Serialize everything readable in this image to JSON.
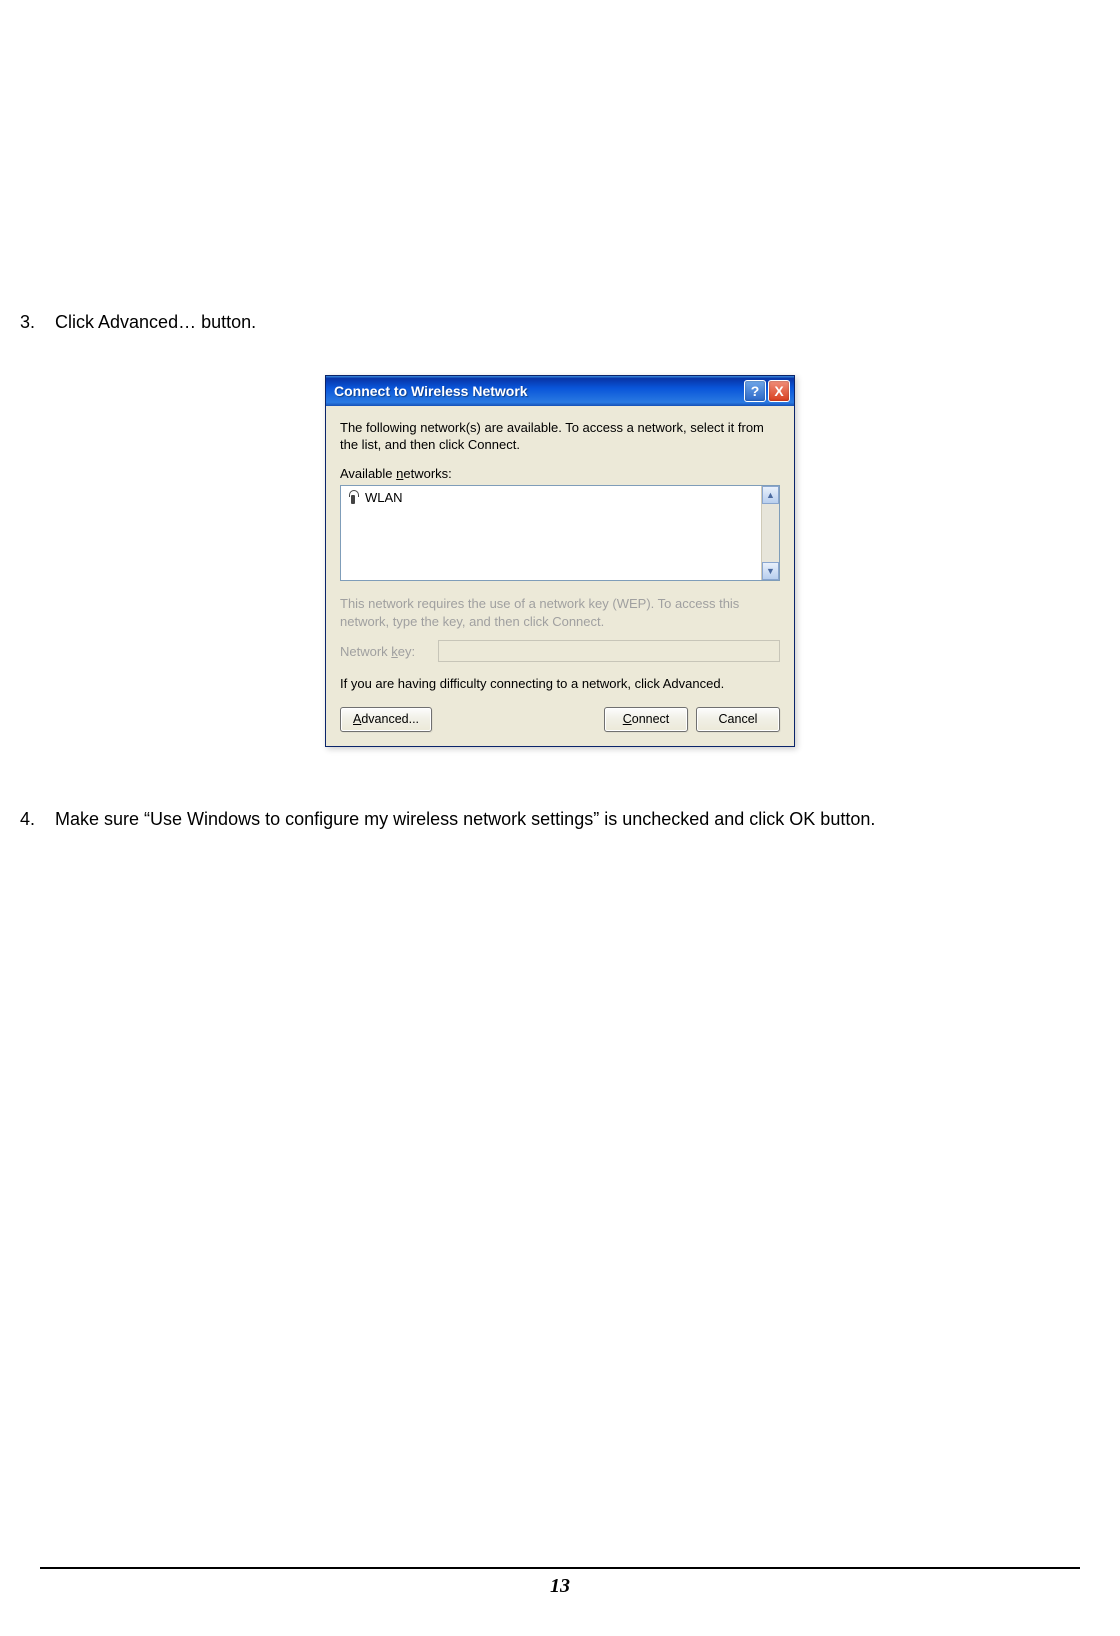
{
  "steps": {
    "s3": {
      "num": "3.",
      "text": "Click Advanced… button."
    },
    "s4": {
      "num": "4.",
      "text": "Make sure “Use Windows to configure my wireless network settings” is unchecked and click OK button."
    }
  },
  "dialog": {
    "title": "Connect to Wireless Network",
    "help_tooltip": "?",
    "close_tooltip": "X",
    "intro": "The following network(s) are available. To access a network, select it from the list, and then click Connect.",
    "available_label_pre": "Available ",
    "available_label_u": "n",
    "available_label_post": "etworks:",
    "network_item": "WLAN",
    "scroll_up": "▲",
    "scroll_down": "▼",
    "wep_note": "This network requires the use of a network key (WEP). To access this network, type the key, and then click Connect.",
    "key_label_pre": "Network ",
    "key_label_u": "k",
    "key_label_post": "ey:",
    "network_key_value": "",
    "difficulty": "If you are having difficulty connecting to a network, click Advanced.",
    "advanced_u": "A",
    "advanced_post": "dvanced...",
    "connect_u": "C",
    "connect_post": "onnect",
    "cancel": "Cancel"
  },
  "page_number": "13"
}
